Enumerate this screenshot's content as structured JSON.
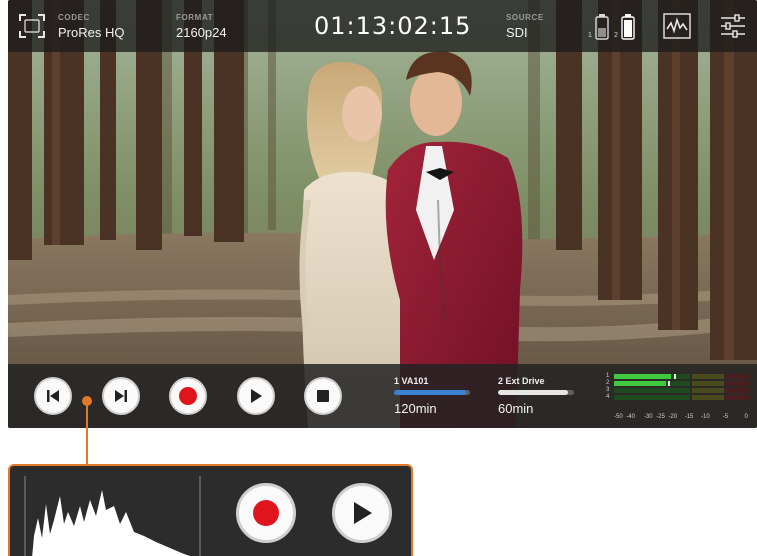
{
  "topbar": {
    "codec_label": "CODEC",
    "codec_value": "ProRes HQ",
    "format_label": "FORMAT",
    "format_value": "2160p24",
    "timecode": "01:13:02:15",
    "source_label": "SOURCE",
    "source_value": "SDI",
    "battery_1": "1",
    "battery_2": "2"
  },
  "media": {
    "slot1_name": "1  VA101",
    "slot1_remaining": "120min",
    "slot1_fill": 0.95,
    "slot2_name": "2  Ext Drive",
    "slot2_remaining": "60min",
    "slot2_fill": 0.92
  },
  "audio_meter": {
    "channels": [
      "1",
      "2",
      "3",
      "4"
    ],
    "scale": [
      "-50",
      "-40",
      "-30",
      "-25",
      "-20",
      "-15",
      "-10",
      "-5",
      "0"
    ]
  },
  "icons": {
    "display": "fullscreen-icon",
    "scopes": "waveform-icon",
    "settings": "sliders-icon",
    "record": "record-icon",
    "play": "play-icon",
    "stop": "stop-icon",
    "skip_prev": "skip-previous-icon",
    "skip_next": "skip-next-icon"
  },
  "colors": {
    "accent": "#e07a2a",
    "record": "#e0141c",
    "slot1_bar": "#3a82d6",
    "slot2_bar": "#e6e6e6",
    "meter_green": "#3ec93e"
  }
}
